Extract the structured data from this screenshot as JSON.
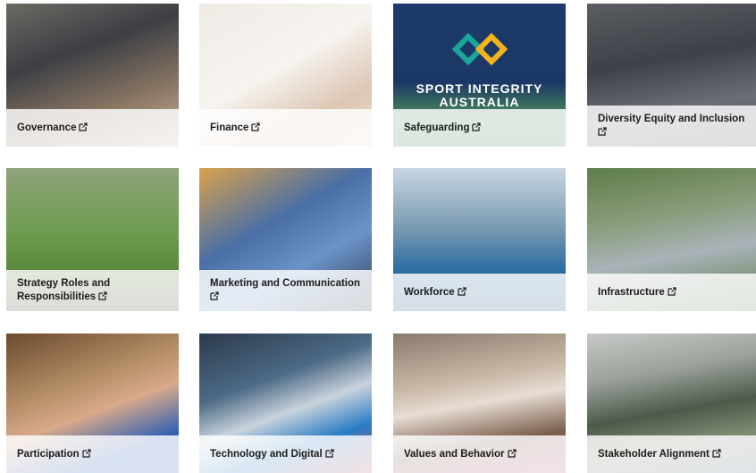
{
  "cards": [
    {
      "label": "Governance"
    },
    {
      "label": "Finance"
    },
    {
      "label": "Safeguarding"
    },
    {
      "label": "Diversity Equity and Inclusion"
    },
    {
      "label": "Strategy Roles and Responsibilities"
    },
    {
      "label": "Marketing and Communication"
    },
    {
      "label": "Workforce"
    },
    {
      "label": "Infrastructure"
    },
    {
      "label": "Participation"
    },
    {
      "label": "Technology and Digital"
    },
    {
      "label": "Values and Behavior"
    },
    {
      "label": "Stakeholder Alignment"
    }
  ],
  "safeguarding_brand": {
    "line1": "SPORT INTEGRITY",
    "line2": "AUSTRALIA"
  },
  "icons": {
    "external": "external-link-icon"
  }
}
